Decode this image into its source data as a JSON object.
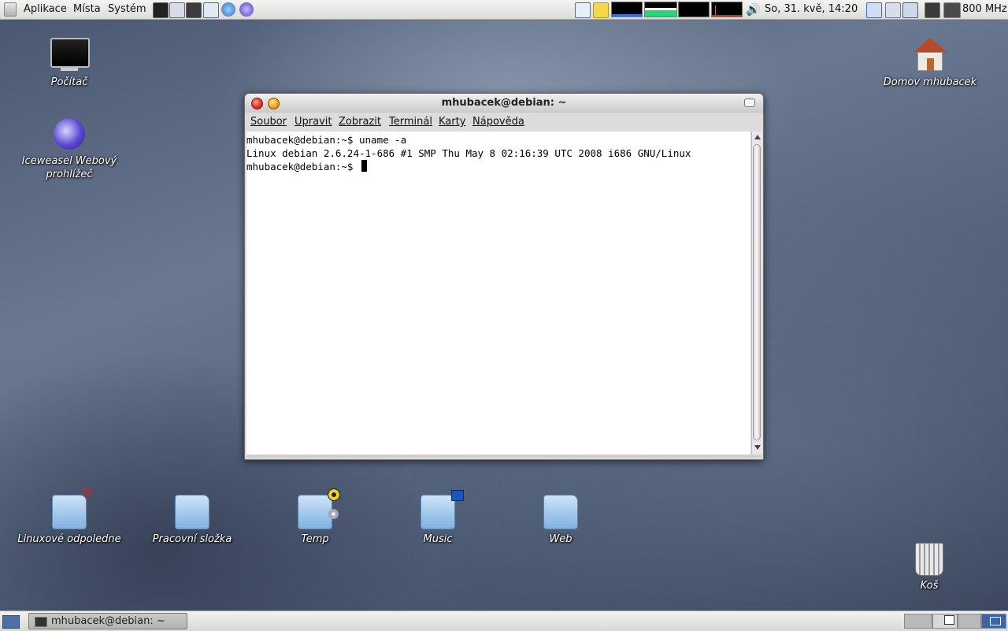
{
  "top_panel": {
    "menu": [
      "Aplikace",
      "Místa",
      "Systém"
    ],
    "clock": "So, 31. kvě, 14:20",
    "cpu_freq": "800 MHz",
    "launcher_icons": [
      "terminal-icon",
      "text-editor-icon",
      "system-monitor-icon",
      "screenshot-icon",
      "help-icon",
      "browser-icon"
    ],
    "tray_icons": [
      "clipboard-icon",
      "notes-icon",
      "volume-icon",
      "network-icon",
      "update-icon",
      "display-icon",
      "power-icon"
    ]
  },
  "desktop": {
    "icons": [
      {
        "label": "Počítač",
        "icon": "computer-icon"
      },
      {
        "label": "Iceweasel Webový prohlížeč",
        "icon": "iceweasel-icon"
      },
      {
        "label": "Domov mhubacek",
        "icon": "home-icon"
      },
      {
        "label": "Linuxové odpoledne",
        "icon": "folder-icon"
      },
      {
        "label": "Pracovní složka",
        "icon": "folder-icon"
      },
      {
        "label": "Temp",
        "icon": "folder-icon"
      },
      {
        "label": "Music",
        "icon": "folder-icon"
      },
      {
        "label": "Web",
        "icon": "folder-icon"
      },
      {
        "label": "Koš",
        "icon": "trash-icon"
      }
    ]
  },
  "terminal": {
    "title": "mhubacek@debian: ~",
    "menu": [
      "Soubor",
      "Upravit",
      "Zobrazit",
      "Terminál",
      "Karty",
      "Nápověda"
    ],
    "lines": [
      "mhubacek@debian:~$ uname -a",
      "Linux debian 2.6.24-1-686 #1 SMP Thu May 8 02:16:39 UTC 2008 i686 GNU/Linux",
      "mhubacek@debian:~$ "
    ]
  },
  "taskbar": {
    "task_label": "mhubacek@debian: ~"
  },
  "colors": {
    "graph_bg": "#000000",
    "graph_green": "#2bd27a",
    "close_button": "#e0332e",
    "minimize_button": "#f0a21e"
  }
}
